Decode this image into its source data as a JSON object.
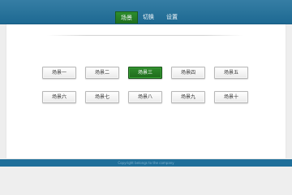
{
  "nav": {
    "items": [
      {
        "label": "场景",
        "active": true
      },
      {
        "label": "切换",
        "active": false
      },
      {
        "label": "设置",
        "active": false
      }
    ]
  },
  "scenes": {
    "row1": [
      "场景一",
      "场景二",
      "场景三",
      "场景四",
      "场景五"
    ],
    "row2": [
      "场景六",
      "场景七",
      "场景八",
      "场景九",
      "场景十"
    ],
    "active_label": "场景三"
  },
  "footer": {
    "text": "Copyright belongs to the company"
  },
  "colors": {
    "topbar": "#1f6f9a",
    "active_green": "#2f8a2c",
    "button_bg": "#eaeaea"
  }
}
